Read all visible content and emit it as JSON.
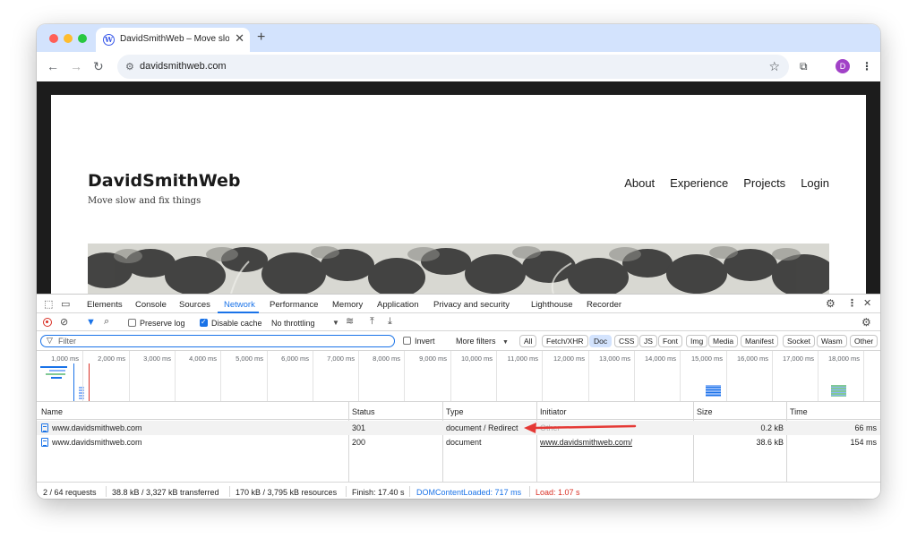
{
  "browser": {
    "tab_title": "DavidSmithWeb – Move slowly and fix things",
    "tab_close": "✕",
    "new_tab": "+",
    "url": "davidsmithweb.com",
    "avatar_letter": "D"
  },
  "site": {
    "title": "DavidSmithWeb",
    "tagline": "Move slow and fix things",
    "nav": [
      "About",
      "Experience",
      "Projects",
      "Login"
    ]
  },
  "devtools": {
    "tabs": [
      "Elements",
      "Console",
      "Sources",
      "Network",
      "Performance",
      "Memory",
      "Application",
      "Privacy and security",
      "Lighthouse",
      "Recorder"
    ],
    "active_tab": "Network",
    "toolbar": {
      "preserve_log": "Preserve log",
      "disable_cache": "Disable cache",
      "throttling": "No throttling"
    },
    "filter": {
      "placeholder": "Filter",
      "invert": "Invert",
      "more_filters": "More filters",
      "types": [
        "All",
        "Fetch/XHR",
        "Doc",
        "CSS",
        "JS",
        "Font",
        "Img",
        "Media",
        "Manifest",
        "Socket",
        "Wasm",
        "Other"
      ],
      "active_type": "Doc"
    },
    "timeline_ticks": [
      "1,000 ms",
      "2,000 ms",
      "3,000 ms",
      "4,000 ms",
      "5,000 ms",
      "6,000 ms",
      "7,000 ms",
      "8,000 ms",
      "9,000 ms",
      "10,000 ms",
      "11,000 ms",
      "12,000 ms",
      "13,000 ms",
      "14,000 ms",
      "15,000 ms",
      "16,000 ms",
      "17,000 ms",
      "18,000 ms"
    ],
    "columns": [
      "Name",
      "Status",
      "Type",
      "Initiator",
      "Size",
      "Time"
    ],
    "rows": [
      {
        "name": "www.davidsmithweb.com",
        "status": "301",
        "type": "document / Redirect",
        "initiator": "Other",
        "size": "0.2 kB",
        "time": "66 ms"
      },
      {
        "name": "www.davidsmithweb.com",
        "status": "200",
        "type": "document",
        "initiator": "www.davidsmithweb.com/",
        "size": "38.6 kB",
        "time": "154 ms"
      }
    ],
    "status_bar": {
      "requests": "2 / 64 requests",
      "transferred": "38.8 kB / 3,327 kB transferred",
      "resources": "170 kB / 3,795 kB resources",
      "finish": "Finish: 17.40 s",
      "dcl": "DOMContentLoaded: 717 ms",
      "load": "Load: 1.07 s"
    },
    "colors": {
      "accent": "#1a73e8",
      "annotation_arrow": "#e53935",
      "dcl": "#1a73e8",
      "load": "#d93025"
    }
  }
}
